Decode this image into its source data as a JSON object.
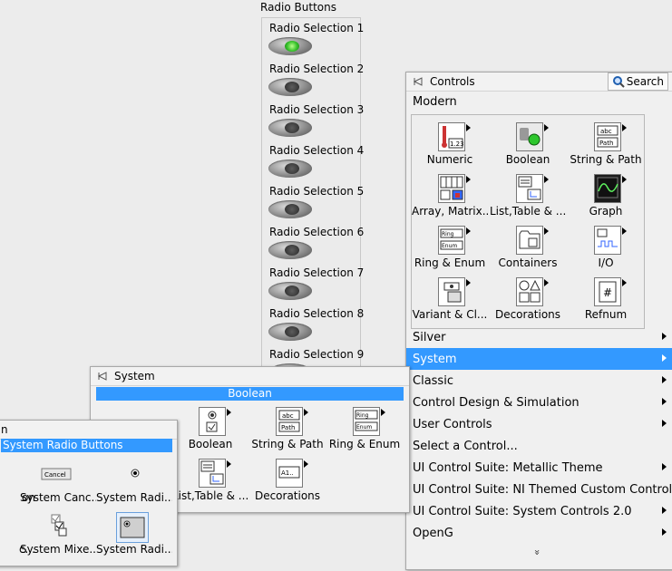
{
  "radio_group": {
    "title": "Radio Buttons",
    "items": [
      {
        "label": "Radio Selection 1",
        "selected": true
      },
      {
        "label": "Radio Selection 2",
        "selected": false
      },
      {
        "label": "Radio Selection 3",
        "selected": false
      },
      {
        "label": "Radio Selection 4",
        "selected": false
      },
      {
        "label": "Radio Selection 5",
        "selected": false
      },
      {
        "label": "Radio Selection 6",
        "selected": false
      },
      {
        "label": "Radio Selection 7",
        "selected": false
      },
      {
        "label": "Radio Selection 8",
        "selected": false
      },
      {
        "label": "Radio Selection 9",
        "selected": false
      }
    ]
  },
  "controls_palette": {
    "title": "Controls",
    "search_label": "Search",
    "section_label": "Modern",
    "tiles": [
      {
        "label": "Numeric",
        "icon": "numeric-icon"
      },
      {
        "label": "Boolean",
        "icon": "boolean-icon"
      },
      {
        "label": "String & Path",
        "icon": "string-path-icon"
      },
      {
        "label": "Array, Matrix...",
        "icon": "array-matrix-icon"
      },
      {
        "label": "List,Table & ...",
        "icon": "list-table-icon"
      },
      {
        "label": "Graph",
        "icon": "graph-icon"
      },
      {
        "label": "Ring & Enum",
        "icon": "ring-enum-icon"
      },
      {
        "label": "Containers",
        "icon": "containers-icon"
      },
      {
        "label": "I/O",
        "icon": "io-icon"
      },
      {
        "label": "Variant & Cl...",
        "icon": "variant-class-icon"
      },
      {
        "label": "Decorations",
        "icon": "decorations-icon"
      },
      {
        "label": "Refnum",
        "icon": "refnum-icon"
      }
    ],
    "categories": [
      {
        "label": "Silver",
        "submenu": true,
        "selected": false
      },
      {
        "label": "System",
        "submenu": true,
        "selected": true
      },
      {
        "label": "Classic",
        "submenu": true,
        "selected": false
      },
      {
        "label": "Control Design & Simulation",
        "submenu": true,
        "selected": false
      },
      {
        "label": "User Controls",
        "submenu": true,
        "selected": false
      },
      {
        "label": "Select a Control...",
        "submenu": false,
        "selected": false
      },
      {
        "label": "UI Control Suite: Metallic Theme",
        "submenu": true,
        "selected": false
      },
      {
        "label": "UI Control Suite: NI Themed Custom Control Su",
        "submenu": true,
        "selected": false
      },
      {
        "label": "UI Control Suite: System Controls 2.0",
        "submenu": true,
        "selected": false
      },
      {
        "label": "OpenG",
        "submenu": true,
        "selected": false
      }
    ],
    "more_indicator": "»"
  },
  "system_palette": {
    "title": "System",
    "selected_band": "Boolean",
    "tiles": [
      {
        "label": "Boolean",
        "icon": "boolean-icon"
      },
      {
        "label": "String & Path",
        "icon": "string-path-icon"
      },
      {
        "label": "Ring & Enum",
        "icon": "ring-enum-icon"
      },
      {
        "label": "List,Table & ...",
        "icon": "list-table-icon"
      },
      {
        "label": "Decorations",
        "icon": "decorations-icon"
      }
    ]
  },
  "system_radio_palette": {
    "title": "n",
    "selected_band": "System Radio Buttons",
    "tiles": [
      {
        "label": "on",
        "icon": "button-icon"
      },
      {
        "label": "System Canc...",
        "icon": "cancel-button-icon",
        "icon_text": "Cancel"
      },
      {
        "label": "System Radi...",
        "icon": "radio-dot-icon"
      },
      {
        "label": "c...",
        "icon": "checkbox-icon"
      },
      {
        "label": "System Mixe...",
        "icon": "mixed-checkbox-icon"
      },
      {
        "label": "System Radi...",
        "icon": "radio-buttons-icon"
      }
    ]
  }
}
